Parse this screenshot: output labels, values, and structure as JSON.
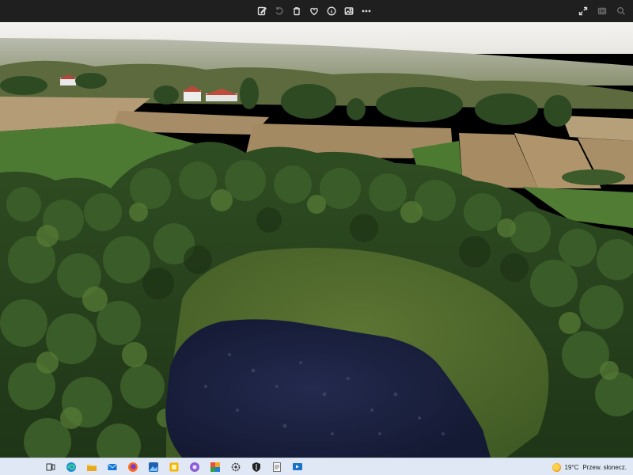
{
  "toolbar": {
    "background": "#1f1f1f",
    "center_buttons": [
      "edit-icon",
      "rotate-icon",
      "delete-icon",
      "favorite-icon",
      "info-icon",
      "image-edit-icon",
      "more-icon"
    ],
    "right_buttons": [
      "fullscreen-icon",
      "slideshow-icon",
      "zoom-icon"
    ]
  },
  "photo": {
    "description_colors": {
      "water": "#1a2040",
      "forest": "#2d4a22",
      "meadow": "#4f6a2c",
      "field": "#a48a62",
      "sky": "#f3f1ee"
    }
  },
  "taskbar": {
    "background": "#dfe8f4",
    "icons": [
      "task-view-icon",
      "edge-icon",
      "file-explorer-icon",
      "mail-icon",
      "firefox-icon",
      "photos-icon",
      "sticky-notes-icon",
      "chrome-icon",
      "media-icon",
      "settings-icon",
      "security-icon",
      "notepad-icon",
      "remote-desktop-icon"
    ]
  },
  "weather": {
    "temperature": "19°C",
    "condition": "Przew. słonecz."
  }
}
